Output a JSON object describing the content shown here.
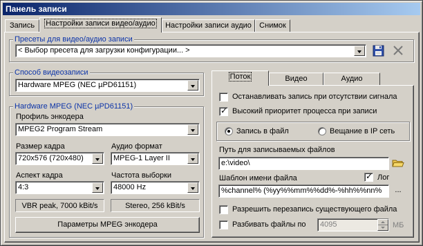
{
  "window": {
    "title": "Панель записи"
  },
  "tabs": [
    {
      "label": "Запись"
    },
    {
      "label": "Настройки записи видео/аудио"
    },
    {
      "label": "Настройки записи аудио"
    },
    {
      "label": "Снимок"
    }
  ],
  "presets": {
    "title": "Пресеты для видео/аудио записи",
    "value": "< Выбор пресета для загрузки конфигурации... >"
  },
  "capture_method": {
    "title": "Способ видеозаписи",
    "value": "Hardware MPEG (NEC µPD61151)"
  },
  "hw_mpeg": {
    "title": "Hardware MPEG (NEC µPD61151)",
    "encoder_profile_label": "Профиль энкодера",
    "encoder_profile_value": "MPEG2 Program Stream",
    "frame_size_label": "Размер кадра",
    "frame_size_value": "720x576 (720x480)",
    "audio_format_label": "Аудио формат",
    "audio_format_value": "MPEG-1 Layer II",
    "aspect_label": "Аспект кадра",
    "aspect_value": "4:3",
    "sample_rate_label": "Частота выборки",
    "sample_rate_value": "48000 Hz",
    "video_status": "VBR peak, 7000 kBit/s",
    "audio_status": "Stereo, 256 kBit/s",
    "params_button": "Параметры MPEG энкодера"
  },
  "subtabs": [
    {
      "label": "Поток"
    },
    {
      "label": "Видео"
    },
    {
      "label": "Аудио"
    }
  ],
  "stream": {
    "stop_on_no_signal": {
      "label": "Останавливать запись при отсутствии сигнала",
      "checked": false
    },
    "high_priority": {
      "label": "Высокий приоритет процесса при записи",
      "checked": true
    },
    "record_to_file": {
      "label": "Запись в файл",
      "checked": true
    },
    "ip_broadcast": {
      "label": "Вещание в IP сеть",
      "checked": false
    },
    "path_label": "Путь для записываемых файлов",
    "path_value": "e:\\video\\",
    "template_label": "Шаблон имени файла",
    "log_label": "Лог",
    "log_checked": true,
    "template_value": "%channel% (%yy%%mm%%dd%-%hh%%nn%",
    "ellipsis_button": "...",
    "allow_overwrite": {
      "label": "Разрешить перезапись существующего файла",
      "checked": false
    },
    "split_files": {
      "label": "Разбивать файлы по",
      "checked": false
    },
    "split_value": "4095",
    "split_unit": "МБ"
  },
  "colors": {
    "group_title": "#0b33a8",
    "title_gradient_start": "#0a246a",
    "title_gradient_end": "#a6caf0",
    "face": "#d4d0c8"
  },
  "icons": {
    "save": "floppy-disk-icon",
    "delete": "close-x-icon",
    "folder": "folder-icon"
  }
}
